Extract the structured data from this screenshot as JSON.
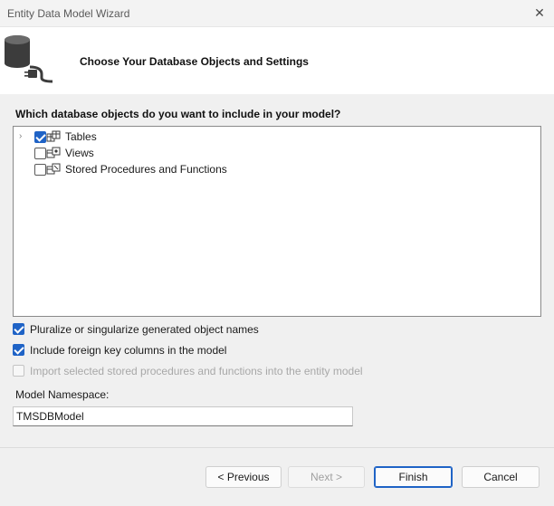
{
  "window": {
    "title": "Entity Data Model Wizard",
    "close_glyph": "✕",
    "close_icon": "close-icon"
  },
  "header": {
    "icon": "database-connector-icon",
    "title": "Choose Your Database Objects and Settings"
  },
  "objects": {
    "question": "Which database objects do you want to include in your model?",
    "items": [
      {
        "label": "Tables",
        "checked": true,
        "expandable": true,
        "icon": "tables-icon"
      },
      {
        "label": "Views",
        "checked": false,
        "expandable": false,
        "icon": "views-icon"
      },
      {
        "label": "Stored Procedures and Functions",
        "checked": false,
        "expandable": false,
        "icon": "stored-procedures-icon"
      }
    ]
  },
  "options": [
    {
      "label": "Pluralize or singularize generated object names",
      "checked": true,
      "enabled": true
    },
    {
      "label": "Include foreign key columns in the model",
      "checked": true,
      "enabled": true
    },
    {
      "label": "Import selected stored procedures and functions into the entity model",
      "checked": false,
      "enabled": false
    }
  ],
  "namespace": {
    "label": "Model Namespace:",
    "value": "TMSDBModel"
  },
  "buttons": {
    "previous": "< Previous",
    "next": "Next >",
    "finish": "Finish",
    "cancel": "Cancel"
  },
  "colors": {
    "accent": "#1f63c6",
    "header_bg": "#ffffff",
    "body_bg": "#f0f0f0"
  }
}
